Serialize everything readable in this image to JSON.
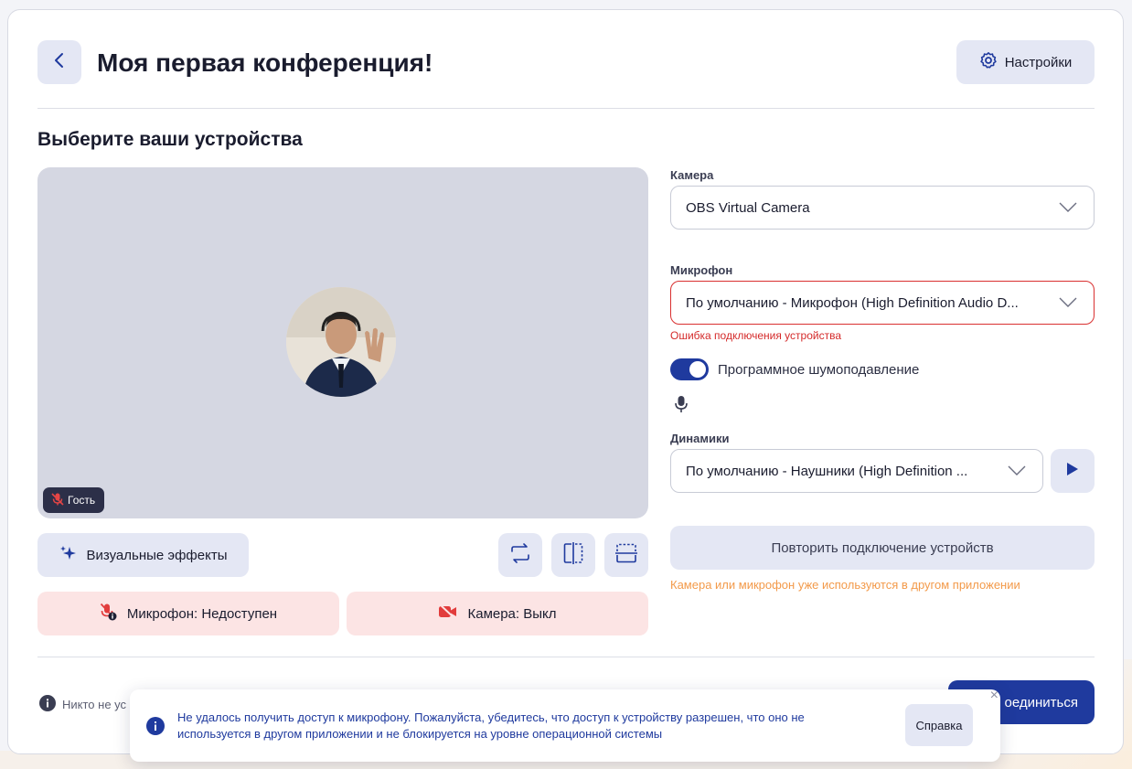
{
  "header": {
    "title": "Моя первая конференция!",
    "settings_label": "Настройки"
  },
  "section_title": "Выберите ваши устройства",
  "preview": {
    "guest_label": "Гость"
  },
  "controls": {
    "effects_label": "Визуальные эффекты",
    "mic_status": "Микрофон: Недоступен",
    "camera_status": "Камера: Выкл"
  },
  "devices": {
    "camera_label": "Камера",
    "camera_value": "OBS Virtual Camera",
    "mic_label": "Микрофон",
    "mic_value": "По умолчанию - Микрофон (High Definition Audio D...",
    "mic_error": "Ошибка подключения устройства",
    "noise_label": "Программное шумоподавление",
    "noise_on": true,
    "speakers_label": "Динамики",
    "speakers_value": "По умолчанию - Наушники (High Definition ..."
  },
  "retry": {
    "label": "Повторить подключение устройств",
    "warning": "Камера или микрофон уже используются в другом приложении"
  },
  "footer": {
    "info_text": "Никто не ус",
    "join_label": "оединиться"
  },
  "toast": {
    "message": "Не удалось получить доступ к микрофону. Пожалуйста, убедитесь, что доступ к устройству разрешен, что оно не используется в другом приложении и не блокируется на уровне операционной системы",
    "help_label": "Справка",
    "close_glyph": "×"
  },
  "colors": {
    "accent": "#1f3a9e",
    "error": "#d93030",
    "warning": "#f39a4a",
    "soft_button": "#e4e7f4",
    "danger_soft": "#fce4e4"
  }
}
